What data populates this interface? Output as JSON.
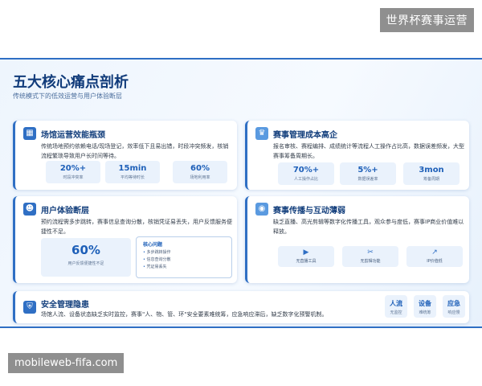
{
  "watermark": "世界杯赛事运营",
  "footer_url": "mobileweb-fifa.com",
  "slide": {
    "title": "五大核心痛点剖析",
    "subtitle": "传统模式下的低效运营与用户体验断层"
  },
  "cards": {
    "venue": {
      "icon": "building-icon",
      "title": "场馆运营效能瓶颈",
      "desc": "传统场地预约依赖电话/现场登记，效率低下且易出错，时段冲突频发，核销流程繁琐导致用户长时间等待。",
      "stats": [
        {
          "value": "20%+",
          "label": "时段冲突率"
        },
        {
          "value": "15min",
          "label": "平均等待时长"
        },
        {
          "value": "60%",
          "label": "场地利用率"
        }
      ]
    },
    "event": {
      "icon": "trophy-icon",
      "title": "赛事管理成本高企",
      "desc": "报名审核、赛程编排、成绩统计等流程人工操作占比高，数据误差频发，大型赛事筹备周期长。",
      "stats": [
        {
          "value": "70%+",
          "label": "人工操作占比"
        },
        {
          "value": "5%+",
          "label": "数据误差率"
        },
        {
          "value": "3mon",
          "label": "筹备周期"
        }
      ]
    },
    "ux": {
      "icon": "user-icon",
      "title": "用户体验断层",
      "desc": "预约流程需多步跳转，赛事信息查询分散，核销凭证易丢失，用户反馈服务便捷性不足。",
      "big_value": "60%",
      "big_label": "用户反馈便捷性不足",
      "issue_title": "核心问题",
      "issues": [
        "多步跳转操作",
        "信息查询分散",
        "凭证易丢失"
      ]
    },
    "broadcast": {
      "icon": "broadcast-icon",
      "title": "赛事传播与互动薄弱",
      "desc": "缺乏直播、高光剪辑等数字化传播工具，观众参与度低，赛事IP商业价值难以释放。",
      "tools": [
        {
          "icon": "video-icon",
          "glyph": "▶",
          "label": "无直播工具"
        },
        {
          "icon": "scissors-icon",
          "glyph": "✂",
          "label": "无剪辑功能"
        },
        {
          "icon": "trend-icon",
          "glyph": "↗",
          "label": "IP价值低"
        }
      ]
    },
    "security": {
      "icon": "shield-icon",
      "title": "安全管理隐患",
      "desc": "场馆人流、设备状态缺乏实时监控，赛事\"人、物、管、环\"安全要素难统筹，应急响应滞后，缺乏数字化预警机制。",
      "chips": [
        {
          "main": "人流",
          "sub": "无监控"
        },
        {
          "main": "设备",
          "sub": "难统筹"
        },
        {
          "main": "应急",
          "sub": "响应慢"
        }
      ]
    }
  },
  "colors": {
    "accent": "#2f6fc4",
    "title": "#103b7a",
    "chip_bg": "#eaf2fc"
  }
}
